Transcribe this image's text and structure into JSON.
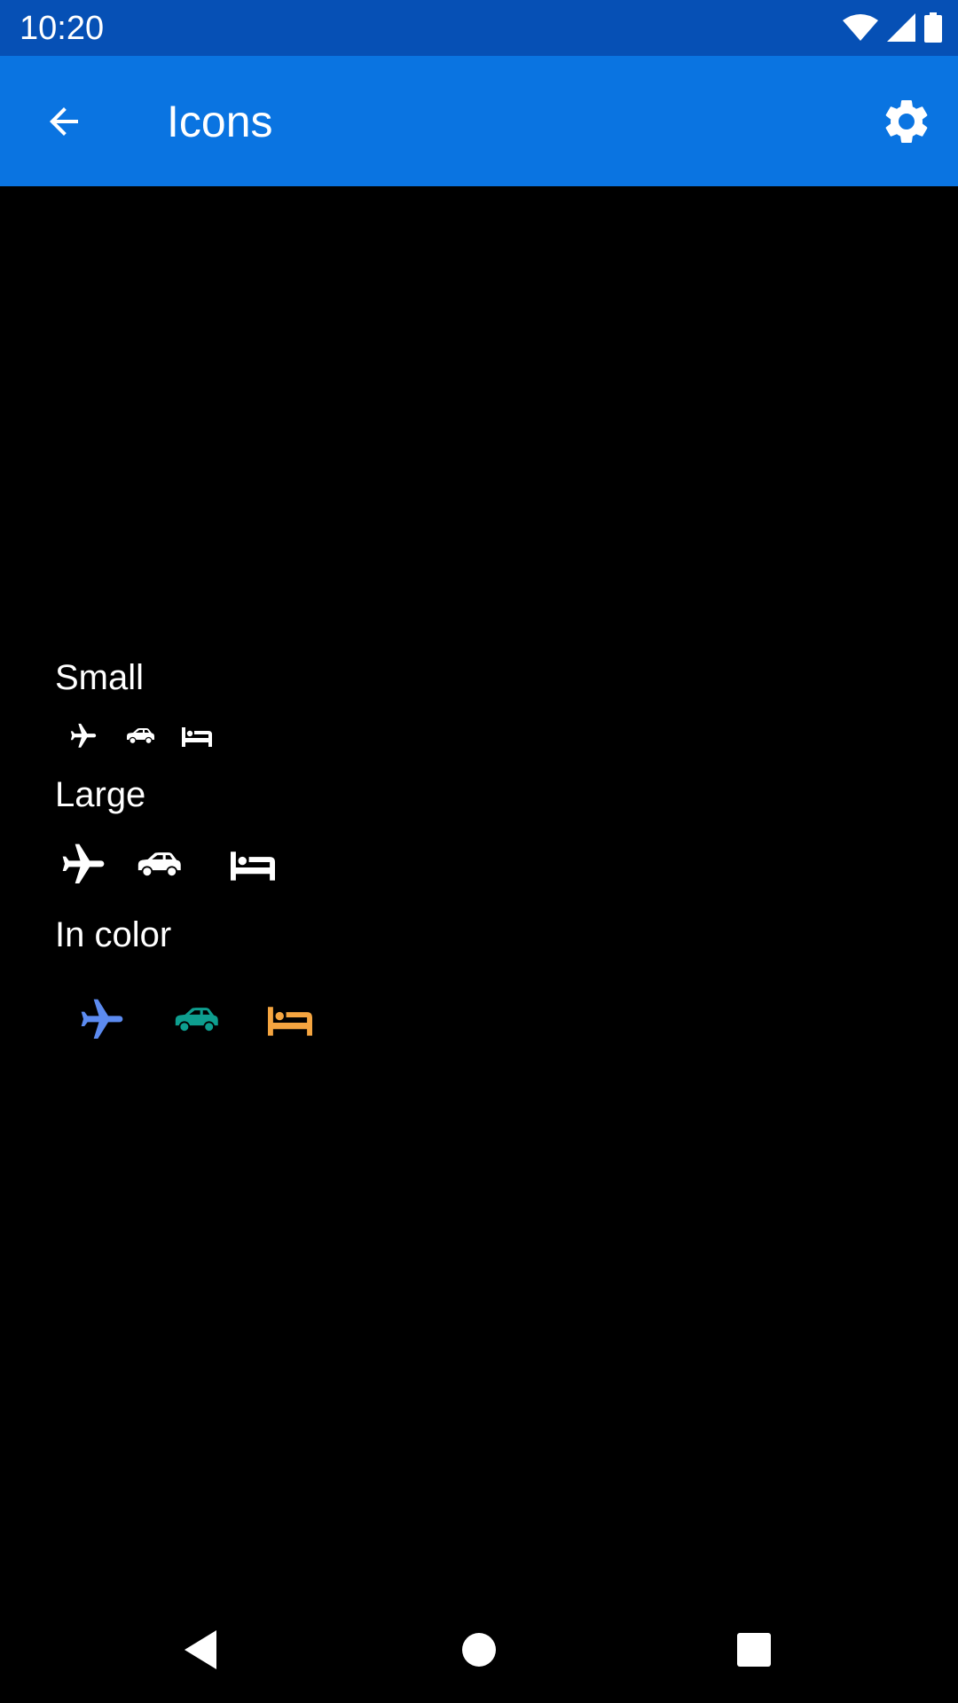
{
  "status_bar": {
    "time": "10:20",
    "icons": [
      "wifi-icon",
      "signal-icon",
      "battery-icon"
    ]
  },
  "app_bar": {
    "title": "Icons",
    "back_icon": "arrow-back-icon",
    "settings_icon": "gear-icon",
    "background": "#0a74e1"
  },
  "sections": [
    {
      "label": "Small",
      "icons": [
        "airplane-icon",
        "car-icon",
        "bed-icon"
      ]
    },
    {
      "label": "Large",
      "icons": [
        "airplane-icon",
        "car-icon",
        "bed-icon"
      ]
    },
    {
      "label": "In color",
      "icons": [
        "airplane-icon",
        "car-icon",
        "bed-icon"
      ]
    }
  ],
  "colors": {
    "status_bar": "#0650b5",
    "app_bar": "#0a74e1",
    "airplane": "#5c8bf0",
    "car": "#0e9e8f",
    "bed": "#f5a540",
    "icon_default": "#ffffff",
    "background": "#000000"
  },
  "nav_bar": {
    "icons": [
      "back-triangle-icon",
      "home-circle-icon",
      "recents-square-icon"
    ]
  }
}
